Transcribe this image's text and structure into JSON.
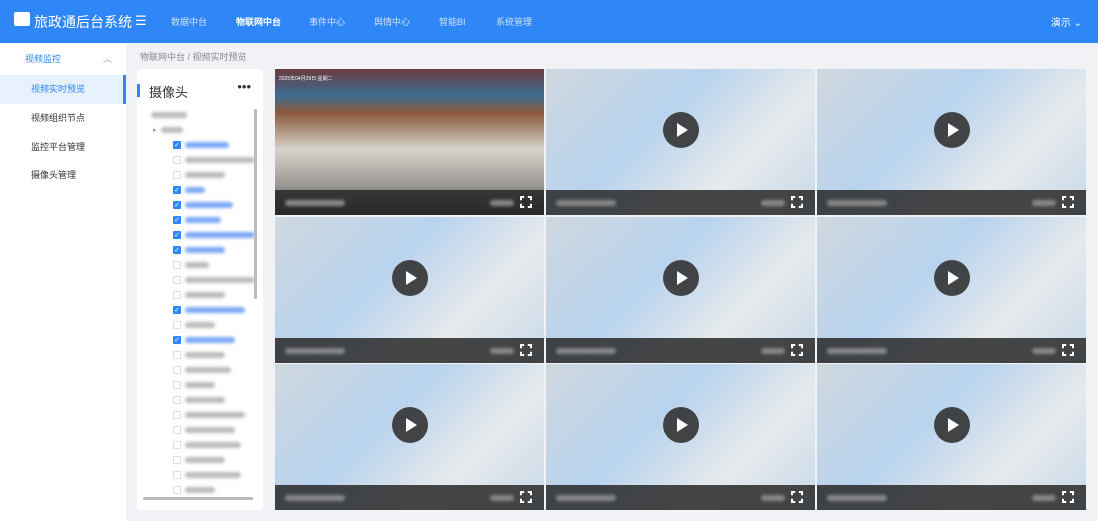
{
  "header": {
    "title": "旅政通后台系统",
    "nav": [
      "数据中台",
      "物联网中台",
      "事件中心",
      "舆情中心",
      "智能BI",
      "系统管理"
    ],
    "active_nav": 1,
    "user": "演示 ⌄"
  },
  "sidebar": {
    "group": "视频监控",
    "items": [
      "视频实时预览",
      "视频组织节点",
      "监控平台管理",
      "摄像头管理"
    ],
    "active": 0
  },
  "breadcrumb": "物联网中台 / 视频实时预览",
  "tree": {
    "title": "摄像头",
    "more": "•••",
    "checked": [
      true,
      false,
      false,
      true,
      true,
      true,
      true,
      true,
      false,
      false,
      false,
      true,
      false,
      true,
      false,
      false,
      false,
      false,
      false,
      false,
      false,
      false,
      false,
      false
    ]
  },
  "tiles": [
    {
      "live": true,
      "timestamp": "2025年04月29日 星期二"
    },
    {
      "live": false
    },
    {
      "live": false
    },
    {
      "live": false
    },
    {
      "live": false
    },
    {
      "live": false
    },
    {
      "live": false
    },
    {
      "live": false
    },
    {
      "live": false
    }
  ]
}
